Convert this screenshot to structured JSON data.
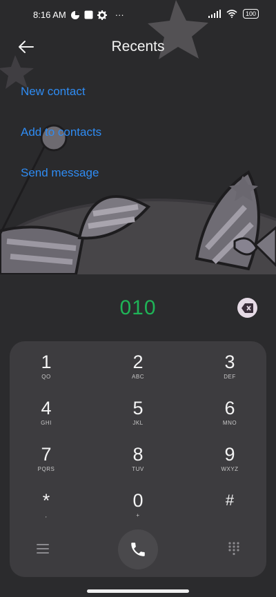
{
  "status": {
    "time": "8:16 AM",
    "more": "···",
    "battery": "100"
  },
  "header": {
    "title": "Recents"
  },
  "actions": {
    "new_contact": "New contact",
    "add_to_contacts": "Add to contacts",
    "send_message": "Send message"
  },
  "dialer": {
    "number": "010"
  },
  "keys": [
    {
      "digit": "1",
      "letters": "QO"
    },
    {
      "digit": "2",
      "letters": "ABC"
    },
    {
      "digit": "3",
      "letters": "DEF"
    },
    {
      "digit": "4",
      "letters": "GHI"
    },
    {
      "digit": "5",
      "letters": "JKL"
    },
    {
      "digit": "6",
      "letters": "MNO"
    },
    {
      "digit": "7",
      "letters": "PQRS"
    },
    {
      "digit": "8",
      "letters": "TUV"
    },
    {
      "digit": "9",
      "letters": "WXYZ"
    },
    {
      "digit": "*",
      "letters": ","
    },
    {
      "digit": "0",
      "letters": "+"
    },
    {
      "digit": "#",
      "letters": ""
    }
  ],
  "colors": {
    "accent": "#2f8cf3",
    "number": "#1fb457",
    "background": "#2b2b2d",
    "keypad": "#3d3c3f"
  }
}
